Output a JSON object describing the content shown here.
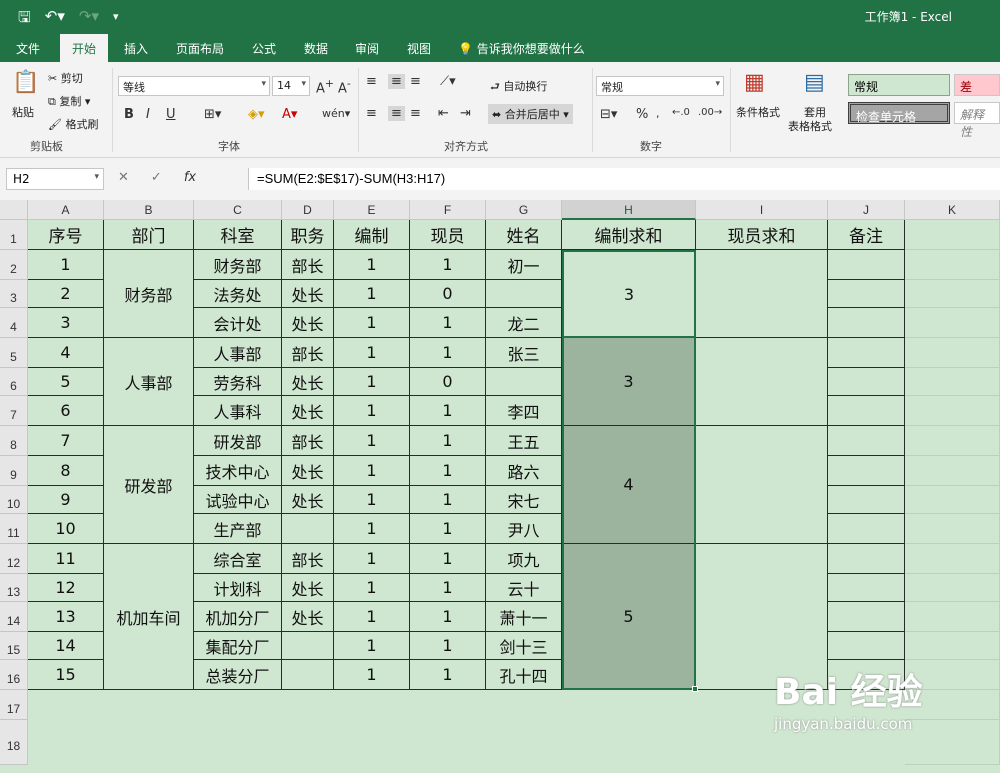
{
  "app": {
    "title": "工作簿1 - Excel"
  },
  "tabs": [
    "文件",
    "开始",
    "插入",
    "页面布局",
    "公式",
    "数据",
    "审阅",
    "视图"
  ],
  "active_tab": "开始",
  "tell_me": "告诉我你想要做什么",
  "ribbon": {
    "clipboard": {
      "paste": "粘贴",
      "cut": "剪切",
      "copy": "复制",
      "format_painter": "格式刷",
      "label": "剪贴板"
    },
    "font": {
      "name": "等线",
      "size": "14",
      "label": "字体",
      "bold": "B",
      "italic": "I",
      "underline": "U"
    },
    "alignment": {
      "wrap": "自动换行",
      "merge": "合并后居中",
      "label": "对齐方式"
    },
    "number": {
      "format": "常规",
      "label": "数字",
      "percent": "%"
    },
    "styles": {
      "conditional": "条件格式",
      "table_format_1": "套用",
      "table_format_2": "表格格式",
      "normal": "常规",
      "bad": "差",
      "check_cell": "检查单元格",
      "explanatory": "解释性"
    }
  },
  "formula_bar": {
    "name_box": "H2",
    "formula": "=SUM(E2:$E$17)-SUM(H3:H17)",
    "fx": "fx"
  },
  "columns": [
    "A",
    "B",
    "C",
    "D",
    "E",
    "F",
    "G",
    "H",
    "I",
    "J",
    "K"
  ],
  "selected_column": "H",
  "row_numbers": [
    "1",
    "2",
    "3",
    "4",
    "5",
    "6",
    "7",
    "8",
    "9",
    "10",
    "11",
    "12",
    "13",
    "14",
    "15",
    "16",
    "17",
    "18"
  ],
  "table": {
    "headers": [
      "序号",
      "部门",
      "科室",
      "职务",
      "编制",
      "现员",
      "姓名",
      "编制求和",
      "现员求和",
      "备注"
    ],
    "rows": [
      [
        "1",
        "财务部",
        "部长",
        "1",
        "1",
        "初一"
      ],
      [
        "2",
        "法务处",
        "处长",
        "1",
        "0",
        ""
      ],
      [
        "3",
        "会计处",
        "处长",
        "1",
        "1",
        "龙二"
      ],
      [
        "4",
        "人事部",
        "部长",
        "1",
        "1",
        "张三"
      ],
      [
        "5",
        "劳务科",
        "处长",
        "1",
        "0",
        ""
      ],
      [
        "6",
        "人事科",
        "处长",
        "1",
        "1",
        "李四"
      ],
      [
        "7",
        "研发部",
        "部长",
        "1",
        "1",
        "王五"
      ],
      [
        "8",
        "技术中心",
        "处长",
        "1",
        "1",
        "路六"
      ],
      [
        "9",
        "试验中心",
        "处长",
        "1",
        "1",
        "宋七"
      ],
      [
        "10",
        "生产部",
        "",
        "1",
        "1",
        "尹八"
      ],
      [
        "11",
        "综合室",
        "部长",
        "1",
        "1",
        "项九"
      ],
      [
        "12",
        "计划科",
        "处长",
        "1",
        "1",
        "云十"
      ],
      [
        "13",
        "机加分厂",
        "处长",
        "1",
        "1",
        "萧十一"
      ],
      [
        "14",
        "集配分厂",
        "",
        "1",
        "1",
        "剑十三"
      ],
      [
        "15",
        "总装分厂",
        "",
        "1",
        "1",
        "孔十四"
      ]
    ],
    "departments": [
      "财务部",
      "人事部",
      "研发部",
      "机加车间"
    ],
    "h_sums": [
      "3",
      "3",
      "4",
      "5"
    ]
  },
  "watermark": {
    "brand": "Bai 经验",
    "url": "jingyan.baidu.com"
  }
}
